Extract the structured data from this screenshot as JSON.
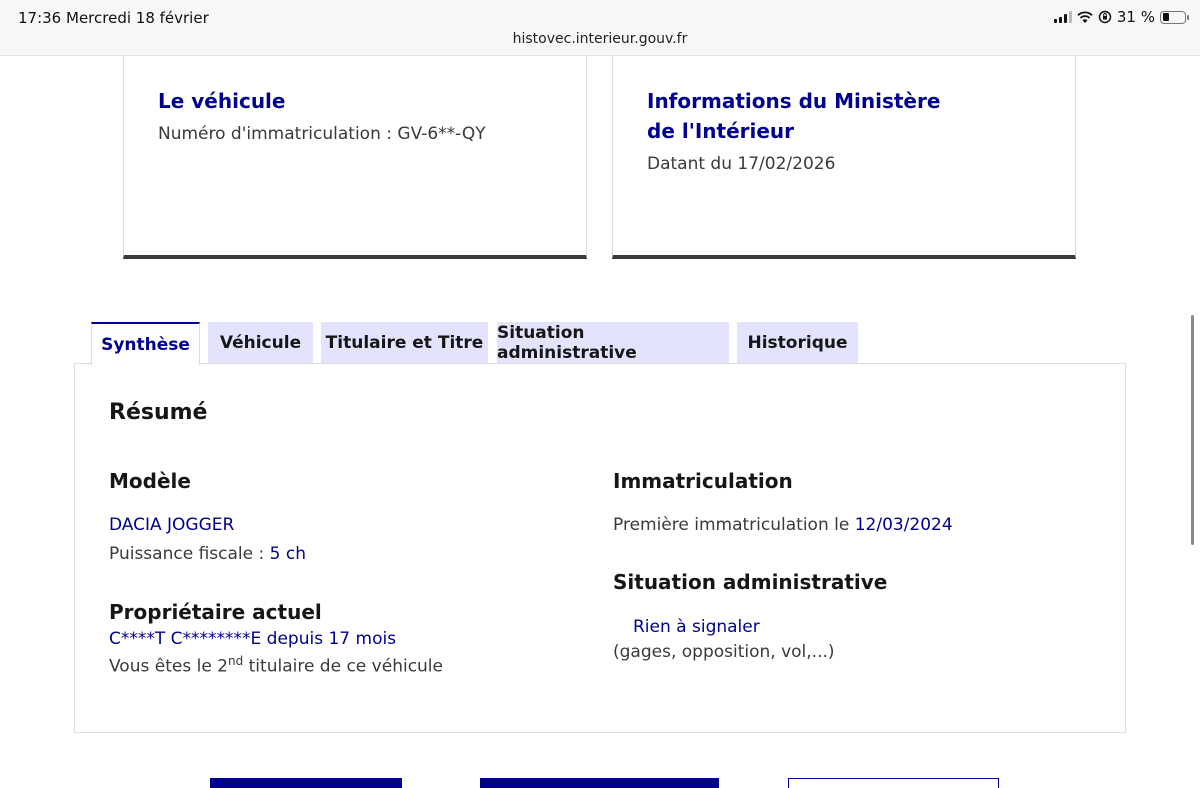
{
  "status_bar": {
    "time": "17:36",
    "date": "Mercredi 18 février",
    "battery": "31 %",
    "url": "histovec.interieur.gouv.fr"
  },
  "cards": {
    "vehicle_title": "Le véhicule",
    "vehicle_plate": "Numéro d'immatriculation : GV-6**-QY",
    "ministry_title": "Informations du Ministère de l'Intérieur",
    "ministry_date": "Datant du 17/02/2026"
  },
  "tabs": [
    {
      "label": "Synthèse"
    },
    {
      "label": "Véhicule"
    },
    {
      "label": "Titulaire et Titre"
    },
    {
      "label": "Situation administrative"
    },
    {
      "label": "Historique"
    }
  ],
  "resume": {
    "title": "Résumé",
    "model_heading": "Modèle",
    "model_value": "DACIA JOGGER",
    "fiscal_label": "Puissance fiscale : ",
    "fiscal_value": "5 ch",
    "owner_heading": "Propriétaire actuel",
    "owner_name": "C****T C********E",
    "owner_since_label": " depuis ",
    "owner_since_value": "17 mois",
    "holder_prefix": "Vous êtes le 2",
    "holder_sup": "nd",
    "holder_suffix": " titulaire de ce véhicule",
    "registration_heading": "Immatriculation",
    "first_reg_label": "Première immatriculation le ",
    "first_reg_date": "12/03/2024",
    "admin_heading": "Situation administrative",
    "admin_status": "Rien à signaler",
    "admin_note": "(gages, opposition, vol,...)"
  },
  "colors": {
    "primary": "#000091",
    "tab_bg": "#e3e3fd",
    "text": "#3a3a3a"
  },
  "icons": [
    "signal-icon",
    "wifi-icon",
    "orientation-lock-icon",
    "battery-icon"
  ]
}
